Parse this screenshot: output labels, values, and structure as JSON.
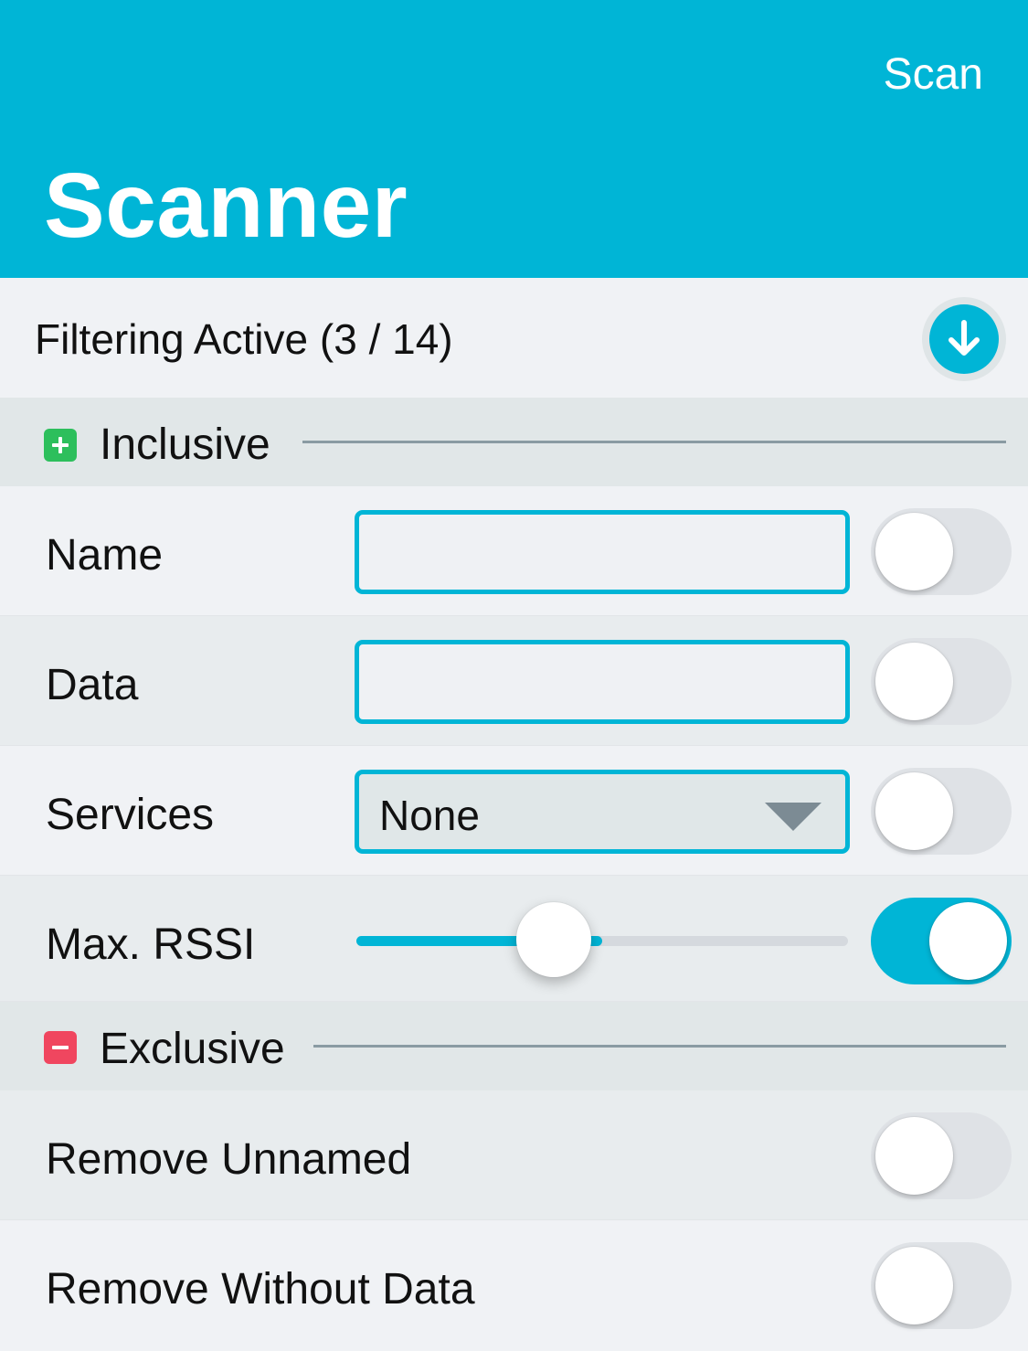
{
  "header": {
    "scan_label": "Scan",
    "title": "Scanner",
    "background": "#00b5d6"
  },
  "filter_bar": {
    "label": "Filtering Active (3 / 14)",
    "collapse_icon": "arrow-down-circle-icon"
  },
  "inclusive": {
    "label": "Inclusive",
    "icon": "plus-square-icon",
    "icon_color": "#2dbf5c",
    "rows": {
      "name": {
        "label": "Name",
        "value": "",
        "enabled": false
      },
      "data": {
        "label": "Data",
        "value": "",
        "enabled": false
      },
      "services": {
        "label": "Services",
        "selected": "None",
        "enabled": false
      },
      "max_rssi": {
        "label": "Max. RSSI",
        "slider_fraction": 0.5,
        "enabled": true
      }
    }
  },
  "exclusive": {
    "label": "Exclusive",
    "icon": "minus-square-icon",
    "icon_color": "#f0465f",
    "rows": {
      "remove_unnamed": {
        "label": "Remove Unnamed",
        "enabled": false
      },
      "remove_without_data": {
        "label": "Remove Without Data",
        "enabled": false
      }
    }
  }
}
